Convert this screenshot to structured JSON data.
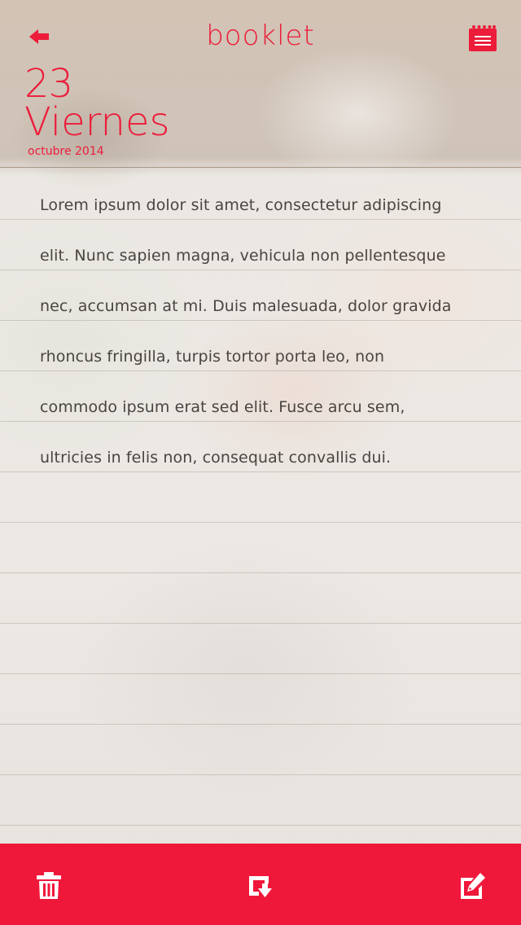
{
  "header": {
    "title": "booklet",
    "back_icon": "back-arrow-icon",
    "calendar_icon": "calendar-menu-icon"
  },
  "date": {
    "day": "23",
    "weekday": "Viernes",
    "month_year": "octubre 2014"
  },
  "note": {
    "lines": [
      "Lorem ipsum dolor sit amet, consectetur adipiscing",
      "elit. Nunc sapien magna, vehicula non pellentesque",
      "nec, accumsan at mi. Duis malesuada, dolor gravida",
      "rhoncus fringilla, turpis tortor porta leo, non",
      "commodo ipsum erat sed elit. Fusce arcu sem,",
      "ultricies in felis non, consequat convallis dui."
    ]
  },
  "toolbar": {
    "delete_icon": "trash-icon",
    "save_icon": "save-down-icon",
    "edit_icon": "edit-pencil-icon"
  },
  "colors": {
    "accent": "#ec1c3a",
    "toolbar": "#f0183a",
    "text": "#4a4441"
  }
}
